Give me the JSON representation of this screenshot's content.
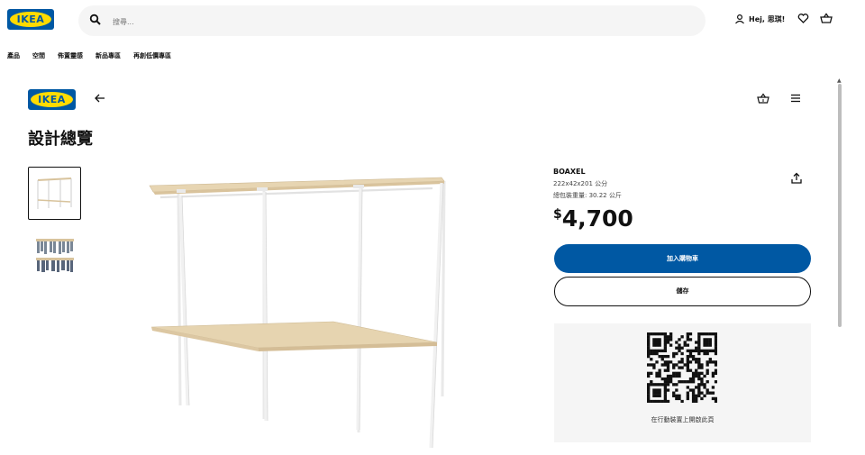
{
  "header": {
    "logo_text": "IKEA",
    "search_placeholder": "搜尋...",
    "user_label": "Hej, 思琪!"
  },
  "nav": [
    "產品",
    "空間",
    "佈置靈感",
    "新品專區",
    "再創低價專區"
  ],
  "page": {
    "logo_text": "IKEA",
    "title": "設計總覽"
  },
  "product": {
    "name": "BOAXEL",
    "dimensions": "222x42x201 公分",
    "weight": "總包裝重量: 30.22 公斤",
    "price_currency": "$",
    "price_value": "4,700",
    "add_to_cart_label": "加入購物車",
    "save_label": "儲存",
    "qr_caption": "在行動裝置上開啟此頁"
  },
  "colors": {
    "brand_blue": "#0058a3",
    "brand_yellow": "#ffdb00"
  },
  "icons": [
    "search-icon",
    "person-icon",
    "heart-icon",
    "cart-icon",
    "back-arrow-icon",
    "basket-icon",
    "menu-icon",
    "share-icon"
  ]
}
